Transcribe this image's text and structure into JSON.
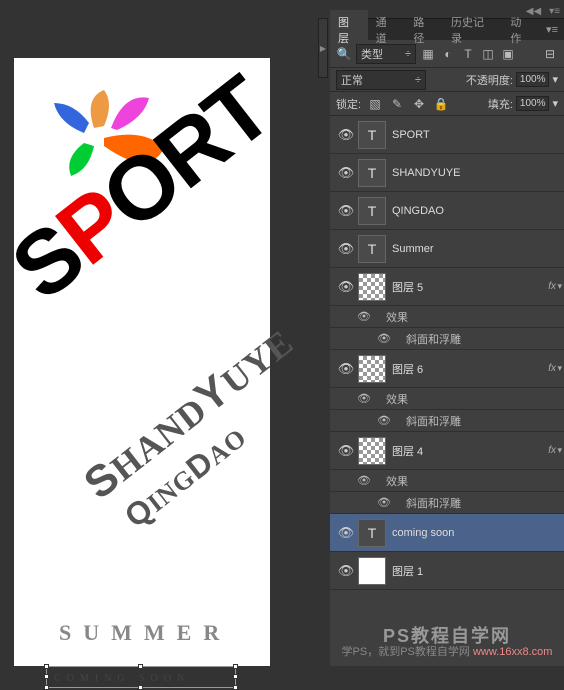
{
  "canvas": {
    "sport": "SPORT",
    "shandy": "SHANDYUYE",
    "qingdao": "QINGDAO",
    "summer": "SUMMER",
    "coming": "COMING SOON"
  },
  "panel": {
    "tabs": {
      "layers": "图层",
      "channels": "通道",
      "paths": "路径",
      "history": "历史记录",
      "actions": "动作"
    },
    "kind_label": "类型",
    "blend": "正常",
    "opacity_label": "不透明度:",
    "opacity_val": "100%",
    "lock_label": "锁定:",
    "fill_label": "填充:",
    "fill_val": "100%"
  },
  "layers": [
    {
      "type": "T",
      "name": "SPORT"
    },
    {
      "type": "T",
      "name": "SHANDYUYE"
    },
    {
      "type": "T",
      "name": "QINGDAO"
    },
    {
      "type": "T",
      "name": "Summer"
    },
    {
      "type": "checker",
      "name": "图层 5",
      "fx": true,
      "effects": [
        "效果",
        "斜面和浮雕"
      ]
    },
    {
      "type": "checker",
      "name": "图层 6",
      "fx": true,
      "effects": [
        "效果",
        "斜面和浮雕"
      ]
    },
    {
      "type": "checker",
      "name": "图层 4",
      "fx": true,
      "effects": [
        "效果",
        "斜面和浮雕"
      ]
    },
    {
      "type": "T",
      "name": "coming soon",
      "selected": true
    },
    {
      "type": "white",
      "name": "图层 1"
    }
  ],
  "footer": {
    "line1": "PS教程自学网",
    "line2a": "学PS，就到PS教程自学网",
    "line2b": "www.16xx8.com"
  },
  "fx_label": "fx"
}
